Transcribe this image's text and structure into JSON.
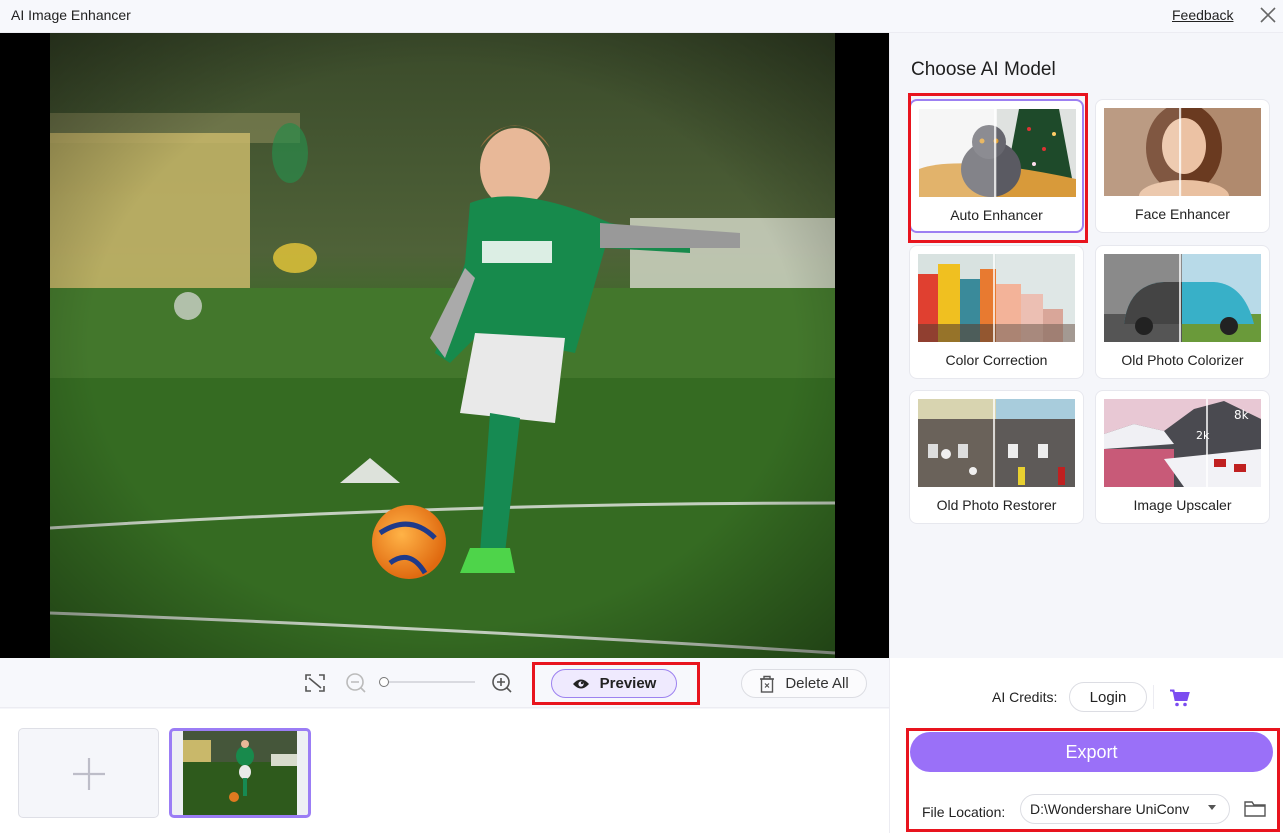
{
  "window": {
    "title": "AI Image Enhancer",
    "feedback_label": "Feedback",
    "close_icon": "close-icon"
  },
  "toolbar": {
    "fit_icon": "fit-screen-icon",
    "zoom_out_icon": "zoom-out-icon",
    "zoom_in_icon": "zoom-in-icon",
    "zoom_level_fraction": 0.0,
    "preview_label": "Preview",
    "preview_icon": "eye-icon",
    "delete_all_label": "Delete All",
    "delete_icon": "trash-icon"
  },
  "thumbnails": {
    "add_icon": "plus-icon",
    "items": [
      {
        "name": "soccer-kid",
        "selected": true
      }
    ]
  },
  "models": {
    "title": "Choose AI Model",
    "items": [
      {
        "label": "Auto Enhancer",
        "selected": true
      },
      {
        "label": "Face Enhancer",
        "selected": false
      },
      {
        "label": "Color Correction",
        "selected": false
      },
      {
        "label": "Old Photo Colorizer",
        "selected": false
      },
      {
        "label": "Old Photo Restorer",
        "selected": false
      },
      {
        "label": "Image Upscaler",
        "selected": false,
        "badges": [
          "2k",
          "8k"
        ]
      }
    ]
  },
  "account": {
    "credits_label": "AI Credits:",
    "login_label": "Login",
    "cart_icon": "cart-icon"
  },
  "export": {
    "export_label": "Export",
    "file_location_label": "File Location:",
    "file_location_value": "D:\\Wondershare UniConv",
    "folder_icon": "folder-icon"
  },
  "colors": {
    "accent": "#9a70f8",
    "highlight": "#e8141e",
    "selected_border": "#9d80f2"
  }
}
